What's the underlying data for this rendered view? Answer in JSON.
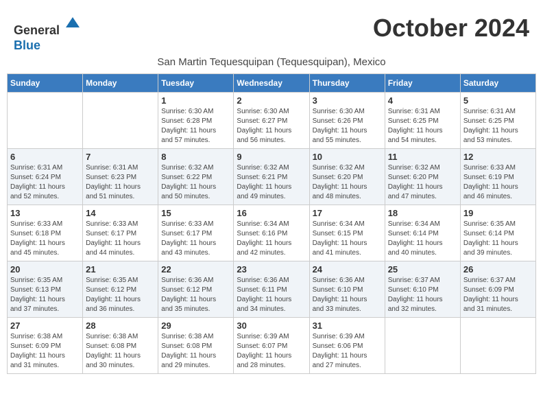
{
  "header": {
    "logo_line1": "General",
    "logo_line2": "Blue",
    "month": "October 2024",
    "subtitle": "San Martin Tequesquipan (Tequesquipan), Mexico"
  },
  "weekdays": [
    "Sunday",
    "Monday",
    "Tuesday",
    "Wednesday",
    "Thursday",
    "Friday",
    "Saturday"
  ],
  "weeks": [
    [
      {
        "day": "",
        "info": ""
      },
      {
        "day": "",
        "info": ""
      },
      {
        "day": "1",
        "info": "Sunrise: 6:30 AM\nSunset: 6:28 PM\nDaylight: 11 hours\nand 57 minutes."
      },
      {
        "day": "2",
        "info": "Sunrise: 6:30 AM\nSunset: 6:27 PM\nDaylight: 11 hours\nand 56 minutes."
      },
      {
        "day": "3",
        "info": "Sunrise: 6:30 AM\nSunset: 6:26 PM\nDaylight: 11 hours\nand 55 minutes."
      },
      {
        "day": "4",
        "info": "Sunrise: 6:31 AM\nSunset: 6:25 PM\nDaylight: 11 hours\nand 54 minutes."
      },
      {
        "day": "5",
        "info": "Sunrise: 6:31 AM\nSunset: 6:25 PM\nDaylight: 11 hours\nand 53 minutes."
      }
    ],
    [
      {
        "day": "6",
        "info": "Sunrise: 6:31 AM\nSunset: 6:24 PM\nDaylight: 11 hours\nand 52 minutes."
      },
      {
        "day": "7",
        "info": "Sunrise: 6:31 AM\nSunset: 6:23 PM\nDaylight: 11 hours\nand 51 minutes."
      },
      {
        "day": "8",
        "info": "Sunrise: 6:32 AM\nSunset: 6:22 PM\nDaylight: 11 hours\nand 50 minutes."
      },
      {
        "day": "9",
        "info": "Sunrise: 6:32 AM\nSunset: 6:21 PM\nDaylight: 11 hours\nand 49 minutes."
      },
      {
        "day": "10",
        "info": "Sunrise: 6:32 AM\nSunset: 6:20 PM\nDaylight: 11 hours\nand 48 minutes."
      },
      {
        "day": "11",
        "info": "Sunrise: 6:32 AM\nSunset: 6:20 PM\nDaylight: 11 hours\nand 47 minutes."
      },
      {
        "day": "12",
        "info": "Sunrise: 6:33 AM\nSunset: 6:19 PM\nDaylight: 11 hours\nand 46 minutes."
      }
    ],
    [
      {
        "day": "13",
        "info": "Sunrise: 6:33 AM\nSunset: 6:18 PM\nDaylight: 11 hours\nand 45 minutes."
      },
      {
        "day": "14",
        "info": "Sunrise: 6:33 AM\nSunset: 6:17 PM\nDaylight: 11 hours\nand 44 minutes."
      },
      {
        "day": "15",
        "info": "Sunrise: 6:33 AM\nSunset: 6:17 PM\nDaylight: 11 hours\nand 43 minutes."
      },
      {
        "day": "16",
        "info": "Sunrise: 6:34 AM\nSunset: 6:16 PM\nDaylight: 11 hours\nand 42 minutes."
      },
      {
        "day": "17",
        "info": "Sunrise: 6:34 AM\nSunset: 6:15 PM\nDaylight: 11 hours\nand 41 minutes."
      },
      {
        "day": "18",
        "info": "Sunrise: 6:34 AM\nSunset: 6:14 PM\nDaylight: 11 hours\nand 40 minutes."
      },
      {
        "day": "19",
        "info": "Sunrise: 6:35 AM\nSunset: 6:14 PM\nDaylight: 11 hours\nand 39 minutes."
      }
    ],
    [
      {
        "day": "20",
        "info": "Sunrise: 6:35 AM\nSunset: 6:13 PM\nDaylight: 11 hours\nand 37 minutes."
      },
      {
        "day": "21",
        "info": "Sunrise: 6:35 AM\nSunset: 6:12 PM\nDaylight: 11 hours\nand 36 minutes."
      },
      {
        "day": "22",
        "info": "Sunrise: 6:36 AM\nSunset: 6:12 PM\nDaylight: 11 hours\nand 35 minutes."
      },
      {
        "day": "23",
        "info": "Sunrise: 6:36 AM\nSunset: 6:11 PM\nDaylight: 11 hours\nand 34 minutes."
      },
      {
        "day": "24",
        "info": "Sunrise: 6:36 AM\nSunset: 6:10 PM\nDaylight: 11 hours\nand 33 minutes."
      },
      {
        "day": "25",
        "info": "Sunrise: 6:37 AM\nSunset: 6:10 PM\nDaylight: 11 hours\nand 32 minutes."
      },
      {
        "day": "26",
        "info": "Sunrise: 6:37 AM\nSunset: 6:09 PM\nDaylight: 11 hours\nand 31 minutes."
      }
    ],
    [
      {
        "day": "27",
        "info": "Sunrise: 6:38 AM\nSunset: 6:09 PM\nDaylight: 11 hours\nand 31 minutes."
      },
      {
        "day": "28",
        "info": "Sunrise: 6:38 AM\nSunset: 6:08 PM\nDaylight: 11 hours\nand 30 minutes."
      },
      {
        "day": "29",
        "info": "Sunrise: 6:38 AM\nSunset: 6:08 PM\nDaylight: 11 hours\nand 29 minutes."
      },
      {
        "day": "30",
        "info": "Sunrise: 6:39 AM\nSunset: 6:07 PM\nDaylight: 11 hours\nand 28 minutes."
      },
      {
        "day": "31",
        "info": "Sunrise: 6:39 AM\nSunset: 6:06 PM\nDaylight: 11 hours\nand 27 minutes."
      },
      {
        "day": "",
        "info": ""
      },
      {
        "day": "",
        "info": ""
      }
    ]
  ]
}
